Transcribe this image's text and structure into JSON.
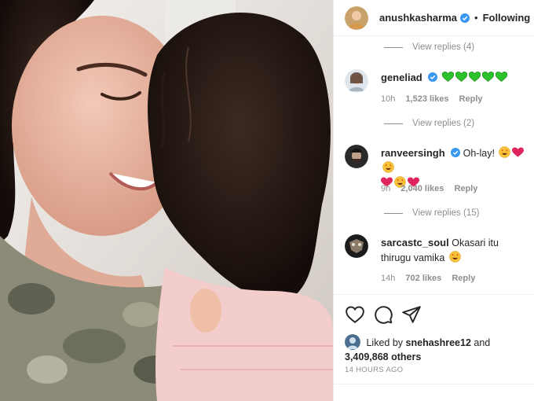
{
  "header": {
    "username": "anushkasharma",
    "separator": "•",
    "follow_label": "Following"
  },
  "replies": [
    {
      "label": "View replies (4)"
    },
    {
      "label": "View replies (2)"
    },
    {
      "label": "View replies (15)"
    }
  ],
  "comments": [
    {
      "username": "geneliad",
      "text": "",
      "emoji": "green-heart x5",
      "time": "10h",
      "likes": "1,523 likes",
      "reply": "Reply"
    },
    {
      "username": "ranveersingh",
      "text": "Oh-lay!",
      "emoji": "star-struck, red-heart, star-struck, red-heart, star-struck, red-heart",
      "time": "9h",
      "likes": "2,040 likes",
      "reply": "Reply"
    },
    {
      "username": "sarcastc_soul",
      "text": "Okasari itu thirugu vamika",
      "emoji": "star-struck",
      "time": "14h",
      "likes": "702 likes",
      "reply": "Reply"
    }
  ],
  "likes": {
    "prefix": "Liked by",
    "user": "snehashree12",
    "and": "and",
    "others": "3,409,868 others"
  },
  "timestamp": "14 HOURS AGO",
  "icons": [
    "heart-icon",
    "comment-icon",
    "share-icon",
    "verified-badge-icon"
  ],
  "colors": {
    "verified": "#3897f0",
    "text": "#262626",
    "muted": "#8e8e8e",
    "green_heart": "#2bc22b",
    "red_heart": "#e0245e"
  }
}
